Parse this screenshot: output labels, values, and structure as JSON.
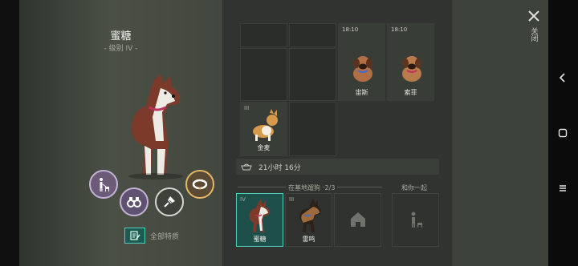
{
  "dog": {
    "name": "蜜糖",
    "level": "- 级别 IV -"
  },
  "actions": {
    "traits_label": "全部特质"
  },
  "kennel": {
    "cells": [
      {
        "name": "宙斯",
        "time": "18:10"
      },
      {
        "name": "索菲",
        "time": "18:10"
      },
      {
        "name": "金麦",
        "tier": "III"
      }
    ]
  },
  "timer": {
    "text": "21小时 16分"
  },
  "base": {
    "label": "在基地遛狗",
    "count": "2/3",
    "with_you_label": "和你一起",
    "slots": [
      {
        "name": "蜜糖",
        "tier": "IV"
      },
      {
        "name": "雷鸣",
        "tier": "III"
      }
    ]
  },
  "close": {
    "label": "关闭"
  },
  "colors": {
    "accent": "#4ed0bd",
    "panel": "#303330"
  }
}
